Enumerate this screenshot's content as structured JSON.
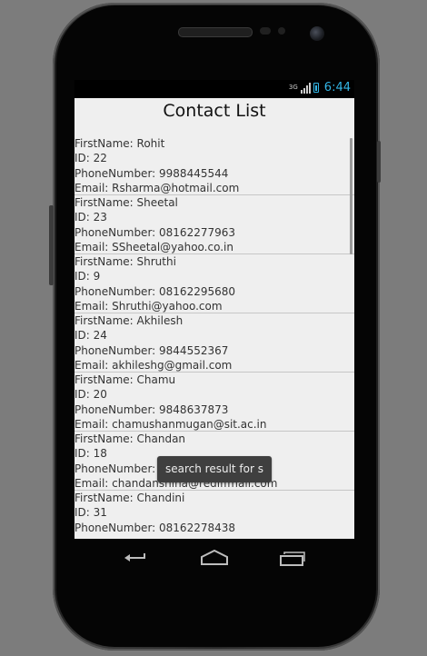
{
  "status_bar": {
    "network_type": "3G",
    "time": "6:44"
  },
  "app": {
    "title": "Contact List"
  },
  "contacts": [
    {
      "first_name": "FirstName: Rohit",
      "id": "ID: 22",
      "phone": "PhoneNumber: 9988445544",
      "email": "Email: Rsharma@hotmail.com"
    },
    {
      "first_name": "FirstName: Sheetal",
      "id": "ID: 23",
      "phone": "PhoneNumber: 08162277963",
      "email": "Email: SSheetal@yahoo.co.in"
    },
    {
      "first_name": "FirstName: Shruthi",
      "id": "ID: 9",
      "phone": "PhoneNumber: 08162295680",
      "email": "Email: Shruthi@yahoo.com"
    },
    {
      "first_name": "FirstName: Akhilesh",
      "id": "ID: 24",
      "phone": "PhoneNumber: 9844552367",
      "email": "Email: akhileshg@gmail.com"
    },
    {
      "first_name": "FirstName: Chamu",
      "id": "ID: 20",
      "phone": "PhoneNumber: 9848637873",
      "email": "Email: chamushanmugan@sit.ac.in"
    },
    {
      "first_name": "FirstName: Chandan",
      "id": "ID: 18",
      "phone": "PhoneNumber: 9",
      "email": "Email: chandanshina@rediffmail.com"
    },
    {
      "first_name": "FirstName: Chandini",
      "id": "ID: 31",
      "phone": "PhoneNumber: 08162278438",
      "email": ""
    }
  ],
  "toast": {
    "message": "search result for s"
  },
  "nav_bar": {
    "icons": [
      "back-icon",
      "home-icon",
      "recent-apps-icon"
    ]
  },
  "colors": {
    "accent": "#33b5e5",
    "screen_background": "#efefef",
    "toast_background": "#3f3f3f"
  }
}
